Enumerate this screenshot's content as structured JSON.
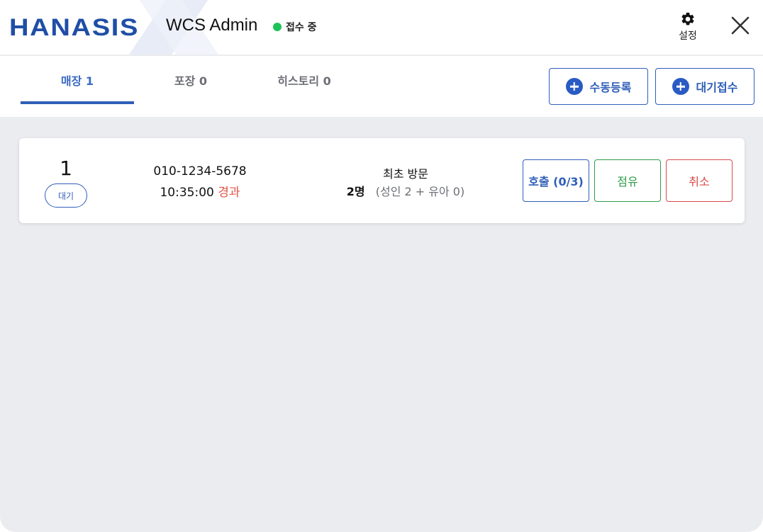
{
  "header": {
    "logo_text": "HANASIS",
    "app_title": "WCS Admin",
    "status_text": "접수 중",
    "status_color": "#1ec357",
    "settings_label": "설정",
    "settings_icon": "gear-icon",
    "close_icon": "close-icon",
    "brand_color": "#1f4ea6"
  },
  "tabs": [
    {
      "label": "매장 1",
      "active": true
    },
    {
      "label": "포장 0",
      "active": false
    },
    {
      "label": "히스토리 0",
      "active": false
    }
  ],
  "actions": {
    "manual_register_label": "수동등록",
    "wait_register_label": "대기접수",
    "icon": "plus-circle-icon"
  },
  "queue_items": [
    {
      "number": "1",
      "badge": "대기",
      "phone": "010-1234-5678",
      "time": "10:35:00",
      "elapsed": "경과",
      "visit": "최초 방문",
      "people_count": "2명",
      "people_detail": "(성인 2 + 유아 0)",
      "call_label": "호출 (0/3)",
      "seat_label": "점유",
      "cancel_label": "취소"
    }
  ]
}
